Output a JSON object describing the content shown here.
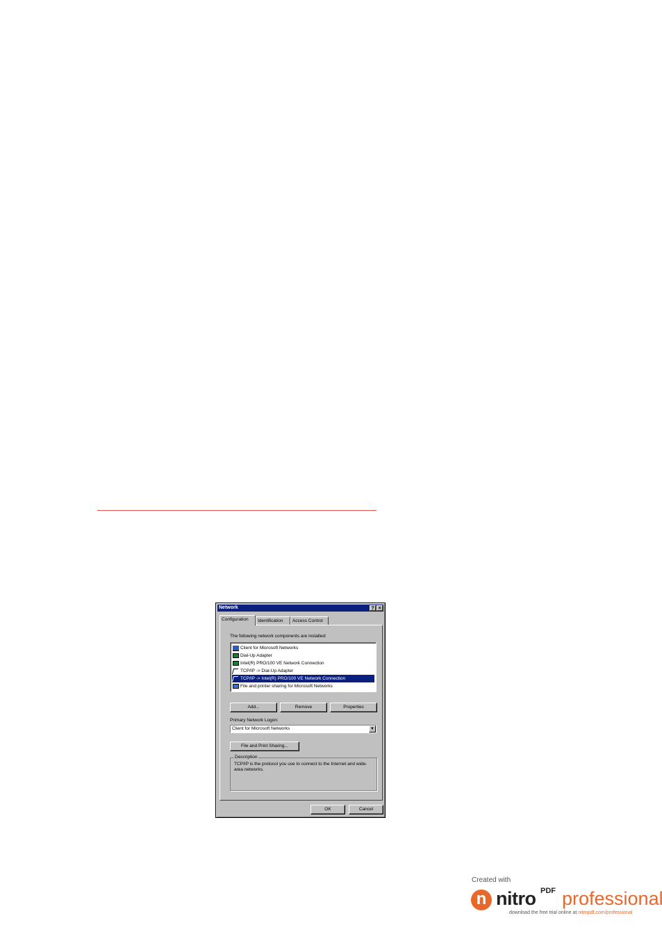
{
  "dialog": {
    "title": "Network",
    "help_button": "?",
    "close_button": "×",
    "tabs": [
      {
        "label": "Configuration"
      },
      {
        "label": "Identification"
      },
      {
        "label": "Access Control"
      }
    ],
    "components_label": "The following network components are installed:",
    "components": [
      {
        "label": "Client for Microsoft Networks",
        "icon": "client-icon"
      },
      {
        "label": "Dial-Up Adapter",
        "icon": "network-adapter-icon"
      },
      {
        "label": "Intel(R) PRO/100 VE Network Connection",
        "icon": "network-adapter-icon"
      },
      {
        "label": "TCP/IP -> Dial-Up Adapter",
        "icon": "protocol-icon"
      },
      {
        "label": "TCP/IP -> Intel(R) PRO/100 VE Network Connection",
        "icon": "protocol-icon",
        "selected": true
      },
      {
        "label": "File and printer sharing for Microsoft Networks",
        "icon": "file-sharing-icon"
      }
    ],
    "buttons": {
      "add": "Add...",
      "remove": "Remove",
      "properties": "Properties",
      "file_print_sharing": "File and Print Sharing...",
      "ok": "OK",
      "cancel": "Cancel"
    },
    "primary_logon_label": "Primary Network Logon:",
    "primary_logon_value": "Client for Microsoft Networks",
    "description_title": "Description",
    "description_text": "TCP/IP is the protocol you use to connect to the Internet and wide-area networks."
  },
  "badge": {
    "created_with": "Created with",
    "logo_letter": "n",
    "brand": "nitro",
    "brand_sup": "PDF",
    "product": "professional",
    "download_text": "download the free trial online at ",
    "download_link": "nitropdf.com/professional",
    "accent_color": "#e8672a"
  },
  "colors": {
    "divider": "#e8504c",
    "titlebar": "#0b1f7e",
    "dialog_face": "#c0c0c0"
  }
}
